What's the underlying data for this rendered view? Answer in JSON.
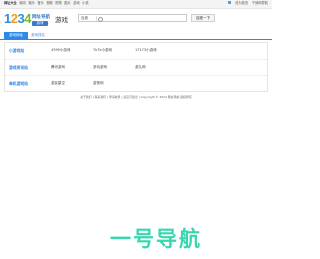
{
  "topbar": {
    "links": [
      "网址大全",
      "新闻",
      "娱乐",
      "音乐",
      "视频",
      "购物",
      "图片",
      "游戏",
      "小说"
    ],
    "right": [
      "设为首页",
      "千娇网导航"
    ]
  },
  "logo": {
    "digits": [
      "1",
      "2",
      "3",
      "4"
    ],
    "cn": "网址导航",
    "badge": "游戏"
  },
  "channel": "游戏",
  "search": {
    "engine": "百度",
    "button": "百度一下"
  },
  "nav": {
    "active_tab": "游戏网址",
    "tab": "游戏排名"
  },
  "rows": [
    {
      "category": "小游戏站",
      "items": [
        "4399小游戏",
        "7k7k小游戏",
        "17173小游戏"
      ]
    },
    {
      "category": "游戏资讯站",
      "items": [
        "腾讯游戏",
        "多玩游戏",
        "游久网"
      ]
    },
    {
      "category": "单机游戏站",
      "items": [
        "游民星空",
        "游侠网",
        ""
      ]
    }
  ],
  "footer": "关于我们 | 联系我们 | 申请收录 | 意见与建议 | Copyright © 2024 网址导航 版权所有",
  "brand": "一号导航",
  "colors": {
    "accent": "#2e8ae6",
    "brand": "#3ad6b0"
  }
}
